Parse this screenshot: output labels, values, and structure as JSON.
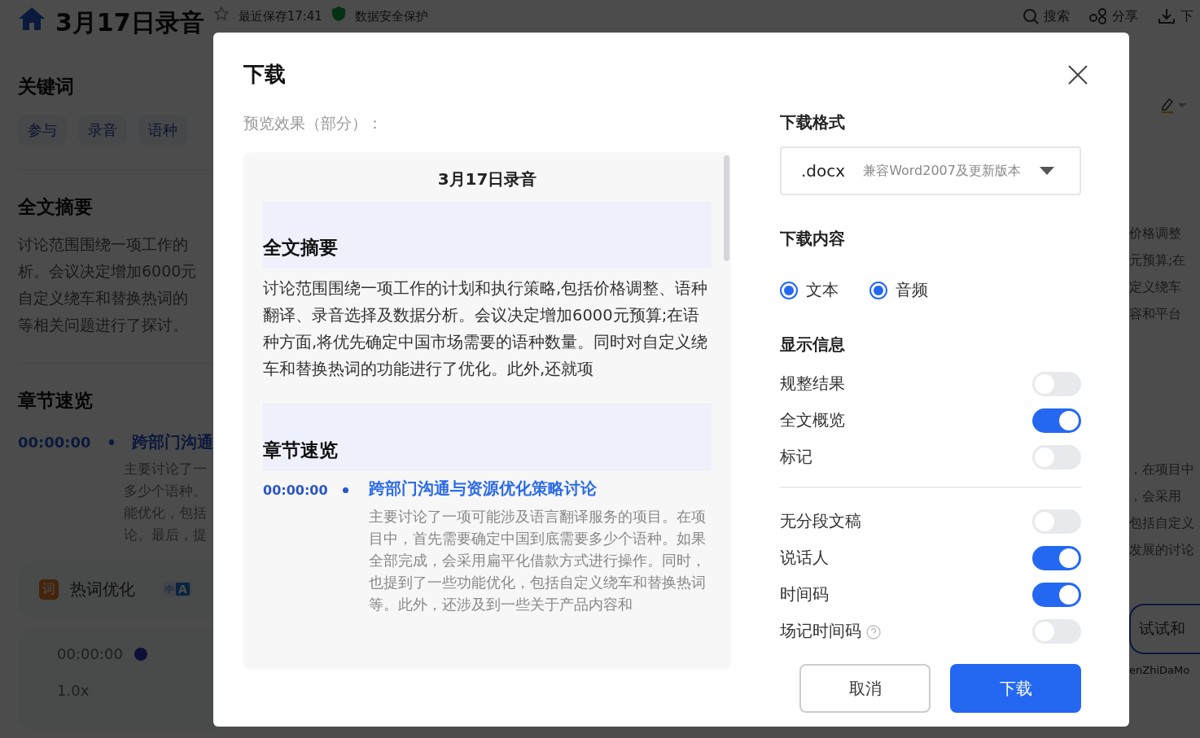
{
  "top_bar": {
    "title": "3月17日录音",
    "saved": "最近保存17:41",
    "security": "数据安全保护",
    "actions": [
      {
        "kind": "search",
        "label": "搜索"
      },
      {
        "kind": "share",
        "label": "分享"
      },
      {
        "kind": "download",
        "label": "下"
      }
    ]
  },
  "keywords": {
    "heading": "关键词",
    "tags": [
      "参与",
      "录音",
      "语种"
    ]
  },
  "summary": {
    "heading": "全文摘要",
    "lines": [
      "讨论范围围绕一项工作的",
      "析。会议决定增加6000元",
      "自定义绕车和替换热词的",
      "等相关问题进行了探讨。"
    ]
  },
  "chapters": {
    "heading": "章节速览",
    "time": "00:00:00",
    "title": "跨部门沟通",
    "lines": [
      "主要讨论了一",
      "多少个语种。",
      "能优化，包括",
      "论。最后，提"
    ]
  },
  "tools": [
    {
      "kind": "hotword",
      "icon_text": "词",
      "label": "热词优化"
    },
    {
      "kind": "translate",
      "icon_text": "中",
      "icon_letter": "A"
    }
  ],
  "player": {
    "time": "00:00:00",
    "speed": "1.0x"
  },
  "right_strip": {
    "lines_top": [
      "价格调整",
      "元预算;在",
      "定义绕车",
      "容和平台"
    ],
    "lines_bottom": [
      "，在项目中",
      "，会采用",
      "包括自定义",
      "发展的讨论"
    ],
    "button": "试试和",
    "footer": "enZhiDaMo"
  },
  "modal": {
    "title": "下载",
    "preview_label": "预览效果（部分）：",
    "preview": {
      "title": "3月17日录音",
      "summary_heading": "全文摘要",
      "summary": "讨论范围围绕一项工作的计划和执行策略,包括价格调整、语种翻译、录音选择及数据分析。会议决定增加6000元预算;在语种方面,将优先确定中国市场需要的语种数量。同时对自定义绕车和替换热词的功能进行了优化。此外,还就项",
      "chapters_heading": "章节速览",
      "time": "00:00:00",
      "chapter_title": "跨部门沟通与资源优化策略讨论",
      "chapter_text": "主要讨论了一项可能涉及语言翻译服务的项目。在项目中，首先需要确定中国到底需要多少个语种。如果全部完成，会采用扁平化借款方式进行操作。同时，也提到了一些功能优化，包括自定义绕车和替换热词等。此外，还涉及到一些关于产品内容和"
    },
    "format": {
      "label": "下载格式",
      "value": ".docx",
      "note": "兼容Word2007及更新版本"
    },
    "content": {
      "label": "下载内容",
      "options": [
        {
          "label": "文本",
          "checked": true
        },
        {
          "label": "音频",
          "checked": true
        }
      ]
    },
    "display": {
      "label": "显示信息",
      "groups": [
        [
          {
            "label": "规整结果",
            "on": false,
            "help": false
          },
          {
            "label": "全文概览",
            "on": true,
            "help": false
          },
          {
            "label": "标记",
            "on": false,
            "help": false
          }
        ],
        [
          {
            "label": "无分段文稿",
            "on": false,
            "help": false
          },
          {
            "label": "说话人",
            "on": true,
            "help": false
          },
          {
            "label": "时间码",
            "on": true,
            "help": false
          },
          {
            "label": "场记时间码",
            "on": false,
            "help": true
          }
        ]
      ]
    },
    "buttons": [
      {
        "kind": "secondary",
        "label": "取消"
      },
      {
        "kind": "primary",
        "label": "下载"
      }
    ]
  }
}
